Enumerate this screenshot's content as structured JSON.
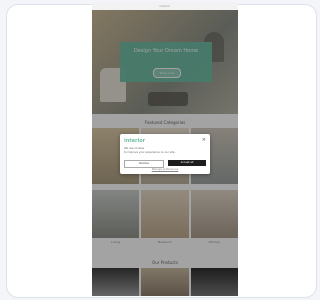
{
  "topbar": {
    "title": "interior"
  },
  "hero": {
    "headline": "Design Your Dream Home",
    "cta_label": "Shop now"
  },
  "sections": {
    "featured_title": "Featured Categories",
    "collections_title": "Our Products"
  },
  "featured_captions": [
    "Living",
    "Bedroom",
    "Kitchen"
  ],
  "modal": {
    "brand": "interior",
    "line1": "We use cookies",
    "line2": "to improve your experience on our site.",
    "decline_label": "Decline",
    "accept_label": "Accept all",
    "link_label": "Manage preferences"
  },
  "colors": {
    "accent": "#6ebca3",
    "dark_button": "#1d1d1d",
    "overlay": "#000000"
  }
}
